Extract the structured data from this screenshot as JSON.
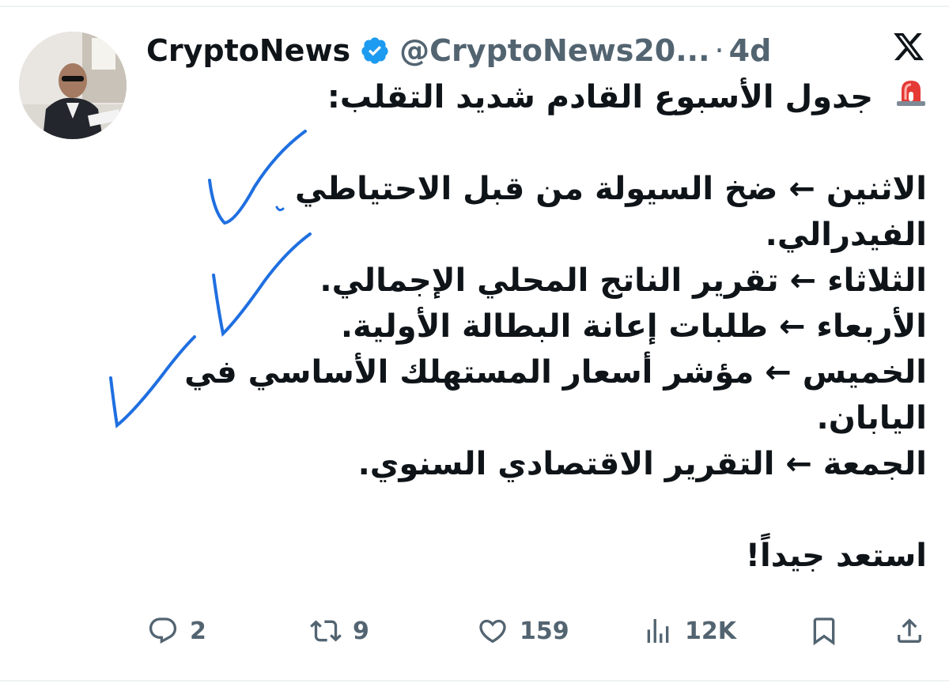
{
  "colors": {
    "text": "#0f1419",
    "muted": "#536471",
    "verified": "#1d9bf0",
    "annotation": "#1f6fe0"
  },
  "author": {
    "display_name": "CryptoNews",
    "handle": "@CryptoNews20...",
    "separator": "·",
    "time": "4d",
    "verified": true
  },
  "tweet": {
    "title": "جدول الأسبوع القادم شديد التقلب:",
    "lines": [
      "الاثنين ← ضخ السيولة من قبل الاحتياطي",
      "الفيدرالي.",
      "الثلاثاء ← تقرير الناتج المحلي الإجمالي.",
      "الأربعاء ← طلبات إعانة البطالة الأولية.",
      "الخميس ← مؤشر أسعار المستهلك الأساسي في",
      "اليابان.",
      "الجمعة ← التقرير الاقتصادي السنوي."
    ],
    "closing": "استعد جيداً!"
  },
  "actions": {
    "replies": "2",
    "reposts": "9",
    "likes": "159",
    "views": "12K"
  },
  "icons": [
    "siren-emoji-icon",
    "verified-badge-icon",
    "x-logo-icon",
    "reply-icon",
    "repost-icon",
    "like-icon",
    "views-icon",
    "bookmark-icon",
    "share-icon"
  ]
}
